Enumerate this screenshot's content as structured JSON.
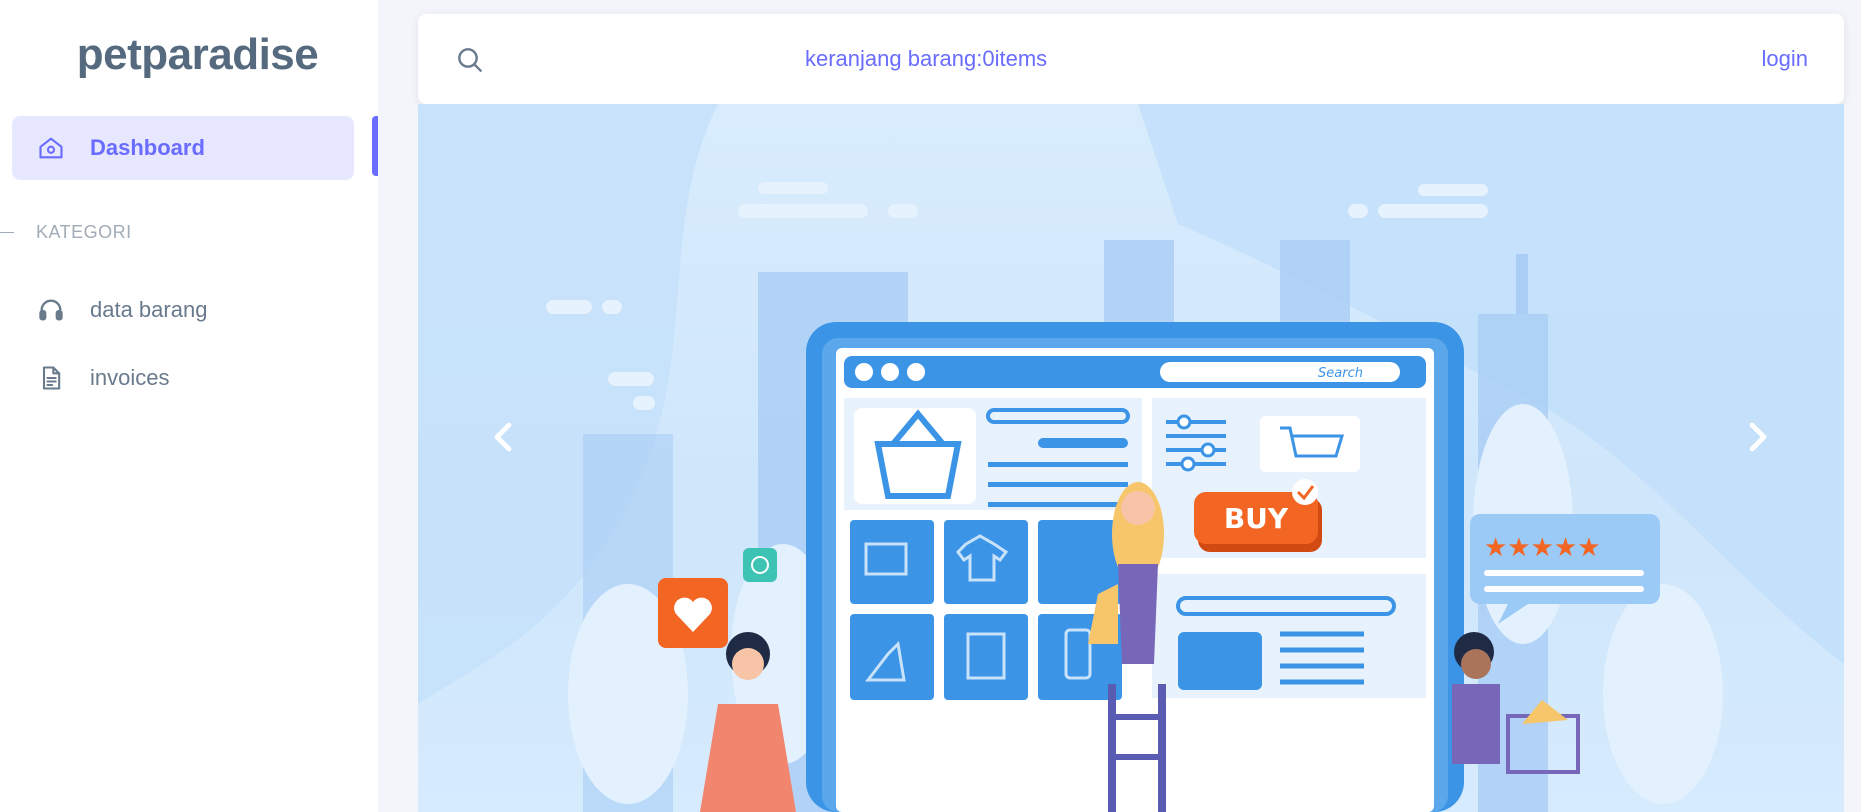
{
  "brand": {
    "name": "petparadise"
  },
  "sidebar": {
    "items": [
      {
        "label": "Dashboard",
        "icon": "home-icon",
        "active": true
      }
    ],
    "section_header": "KATEGORI",
    "category_items": [
      {
        "label": "data barang",
        "icon": "headphones-icon"
      },
      {
        "label": "invoices",
        "icon": "file-text-icon"
      }
    ]
  },
  "navbar": {
    "search_icon": "search-icon",
    "cart_text": "keranjang barang:0items",
    "login_label": "login"
  },
  "carousel": {
    "banner_search_label": "Search",
    "buy_label": "BUY",
    "prev_icon": "chevron-left-icon",
    "next_icon": "chevron-right-icon",
    "rating_stars": 4.5
  },
  "colors": {
    "accent": "#696cff",
    "accent_bg": "#e7e7ff",
    "text": "#697a8d",
    "brand_text": "#566a7f",
    "buy_button": "#f26522"
  }
}
